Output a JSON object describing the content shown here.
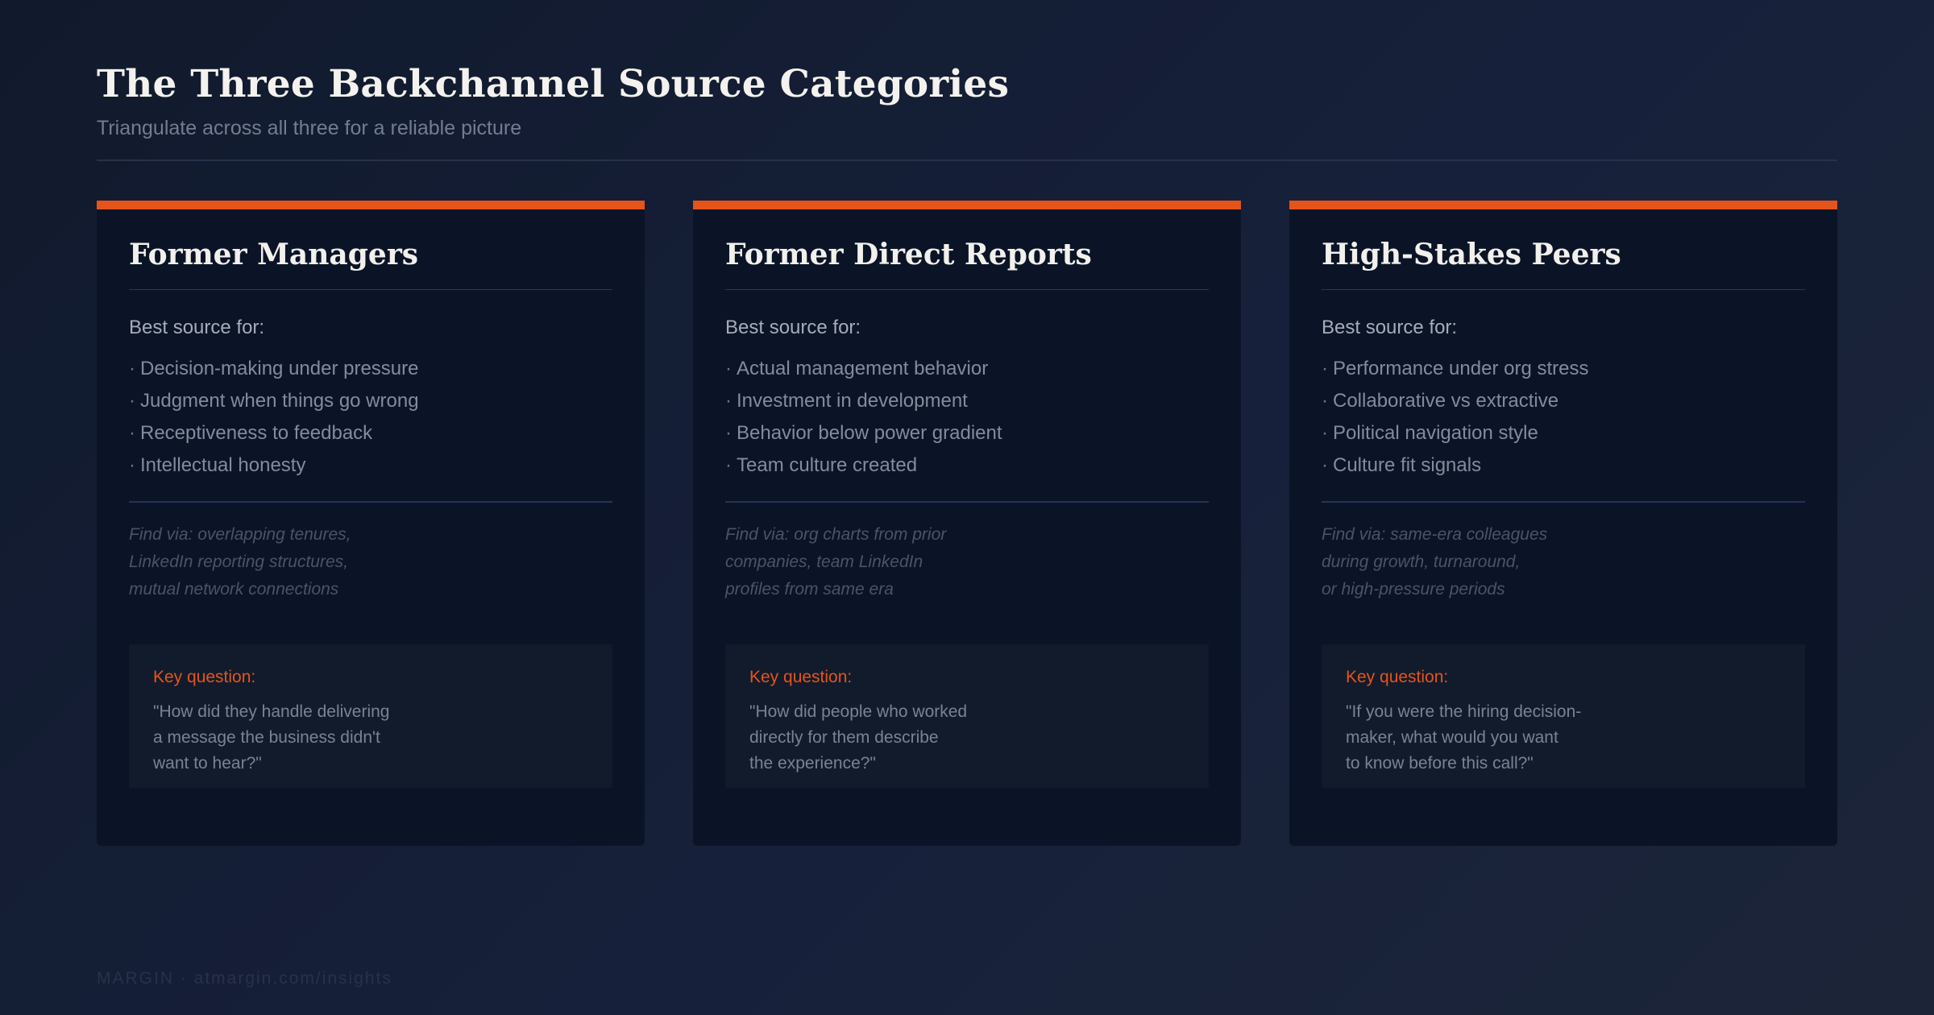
{
  "header": {
    "title": "The Three Backchannel Source Categories",
    "subtitle": "Triangulate across all three for a reliable picture"
  },
  "colors": {
    "accent": "#e5541a",
    "background": "#131c30",
    "card": "#0b1427"
  },
  "cards": [
    {
      "title": "Former Managers",
      "best_label": "Best source for:",
      "bullets": [
        "Decision-making under pressure",
        "Judgment when things go wrong",
        "Receptiveness to feedback",
        "Intellectual honesty"
      ],
      "find_via": [
        "Find via: overlapping tenures,",
        "LinkedIn reporting structures,",
        "mutual network connections"
      ],
      "key_label": "Key question:",
      "key_question": [
        "\"How did they handle delivering",
        "a message the business didn't",
        "want to hear?\""
      ]
    },
    {
      "title": "Former Direct Reports",
      "best_label": "Best source for:",
      "bullets": [
        "Actual management behavior",
        "Investment in development",
        "Behavior below power gradient",
        "Team culture created"
      ],
      "find_via": [
        "Find via: org charts from prior",
        "companies, team LinkedIn",
        "profiles from same era"
      ],
      "key_label": "Key question:",
      "key_question": [
        "\"How did people who worked",
        "directly for them describe",
        "the experience?\""
      ]
    },
    {
      "title": "High-Stakes Peers",
      "best_label": "Best source for:",
      "bullets": [
        "Performance under org stress",
        "Collaborative vs extractive",
        "Political navigation style",
        "Culture fit signals"
      ],
      "find_via": [
        "Find via: same-era colleagues",
        "during growth, turnaround,",
        "or high-pressure periods"
      ],
      "key_label": "Key question:",
      "key_question": [
        "\"If you were the hiring decision-",
        "maker, what would you want",
        "to know before this call?\""
      ]
    }
  ],
  "footer": {
    "text": "MARGIN · atmargin.com/insights"
  }
}
